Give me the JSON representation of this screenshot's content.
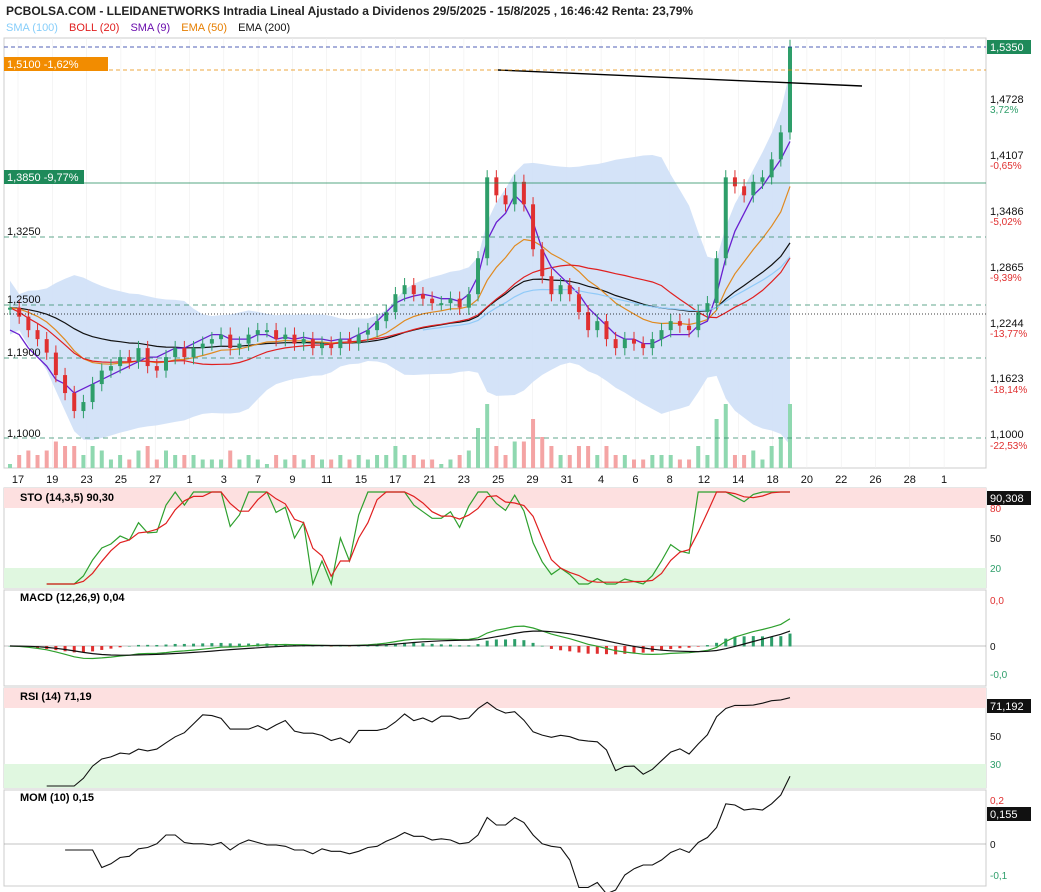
{
  "header": {
    "title": "PCBOLSA.COM - LLEIDANETWORKS Intradia Lineal Ajustado a Dividenos 29/5/2025 - 15/8/2025 , 16:46:42 Renta: 23,79%"
  },
  "legend": [
    {
      "label": "SMA (100)",
      "color": "#87cefa"
    },
    {
      "label": "BOLL (20)",
      "color": "#e02020"
    },
    {
      "label": "SMA (9)",
      "color": "#6a0dad"
    },
    {
      "label": "EMA (50)",
      "color": "#e67e00"
    },
    {
      "label": "EMA (200)",
      "color": "#111111"
    }
  ],
  "colors": {
    "up": "#2e9e6a",
    "down": "#e03030",
    "boll_fill": "#cfe0f7",
    "sma9": "#6a20d0",
    "boll_mid": "#e02020",
    "ema50": "#e08a20",
    "ema200": "#111111",
    "sma100": "#90caf8",
    "grid": "#e6e6e6",
    "orange_badge": "#f28c00",
    "green_badge": "#1e8a5a"
  },
  "price_axis": {
    "labels": [
      "1,5350",
      "1,4728",
      "1,4107",
      "1,3486",
      "1,2865",
      "1,2244",
      "1,1623",
      "1,1000"
    ],
    "percents": [
      "3,72%",
      "-0,65%",
      "-5,02%",
      "-9,39%",
      "-13,77%",
      "-18,14%",
      "-22,53%"
    ],
    "current": "1,5350"
  },
  "levels": {
    "resistance_badge": "1,5100  -1,62%",
    "support_badge": "1,3850  -9,77%",
    "left_labels": [
      "1,3250",
      "1,2500",
      "1,1900",
      "1,1000"
    ]
  },
  "x_axis": {
    "labels": [
      "17",
      "19",
      "23",
      "25",
      "27",
      "1",
      "3",
      "7",
      "9",
      "11",
      "15",
      "17",
      "21",
      "23",
      "25",
      "29",
      "31",
      "4",
      "6",
      "8",
      "12",
      "14",
      "18",
      "20",
      "22",
      "26",
      "28",
      "1"
    ]
  },
  "indicators": {
    "sto": {
      "label": "STO (14,3,5)",
      "value": "90,30",
      "box": "90,308",
      "levels": [
        "80",
        "50",
        "20"
      ]
    },
    "macd": {
      "label": "MACD (12,26,9)",
      "value": "0,04",
      "levels": [
        "0,0",
        "0",
        "-0,0"
      ]
    },
    "rsi": {
      "label": "RSI (14)",
      "value": "71,19",
      "box": "71,192",
      "levels": [
        "50",
        "30"
      ]
    },
    "mom": {
      "label": "MOM (10)",
      "value": "0,15",
      "box": "0,155",
      "levels": [
        "0,2",
        "0",
        "-0,1"
      ]
    }
  },
  "chart_data": {
    "type": "line",
    "title": "PCBOLSA.COM - LLEIDANETWORKS Intradia Lineal Ajustado a Dividenos 29/5/2025 - 15/8/2025 , 16:46:42 Renta: 23,79%",
    "ylim": [
      1.1,
      1.535
    ],
    "close": [
      1.245,
      1.235,
      1.22,
      1.21,
      1.195,
      1.17,
      1.15,
      1.13,
      1.14,
      1.16,
      1.175,
      1.18,
      1.19,
      1.185,
      1.2,
      1.18,
      1.175,
      1.19,
      1.2,
      1.19,
      1.2,
      1.205,
      1.21,
      1.215,
      1.2,
      1.205,
      1.215,
      1.22,
      1.22,
      1.21,
      1.215,
      1.205,
      1.21,
      1.2,
      1.205,
      1.2,
      1.21,
      1.205,
      1.215,
      1.22,
      1.23,
      1.24,
      1.26,
      1.27,
      1.26,
      1.255,
      1.25,
      1.25,
      1.255,
      1.245,
      1.26,
      1.3,
      1.39,
      1.37,
      1.36,
      1.385,
      1.36,
      1.31,
      1.28,
      1.26,
      1.27,
      1.26,
      1.24,
      1.22,
      1.23,
      1.21,
      1.2,
      1.21,
      1.205,
      1.2,
      1.21,
      1.22,
      1.23,
      1.225,
      1.22,
      1.24,
      1.25,
      1.3,
      1.39,
      1.38,
      1.37,
      1.385,
      1.39,
      1.41,
      1.44,
      1.535
    ],
    "sma9": [
      1.22,
      1.215,
      1.2,
      1.19,
      1.18,
      1.165,
      1.16,
      1.15,
      1.155,
      1.16,
      1.165,
      1.17,
      1.175,
      1.18,
      1.185,
      1.19,
      1.19,
      1.195,
      1.2,
      1.2,
      1.205,
      1.21,
      1.215,
      1.215,
      1.21,
      1.21,
      1.21,
      1.215,
      1.215,
      1.21,
      1.212,
      1.21,
      1.212,
      1.21,
      1.21,
      1.208,
      1.21,
      1.21,
      1.215,
      1.22,
      1.23,
      1.24,
      1.25,
      1.255,
      1.258,
      1.26,
      1.258,
      1.255,
      1.255,
      1.252,
      1.26,
      1.28,
      1.32,
      1.34,
      1.35,
      1.37,
      1.36,
      1.34,
      1.31,
      1.29,
      1.28,
      1.27,
      1.26,
      1.245,
      1.235,
      1.225,
      1.215,
      1.21,
      1.21,
      1.205,
      1.205,
      1.21,
      1.215,
      1.215,
      1.215,
      1.225,
      1.23,
      1.26,
      1.3,
      1.33,
      1.35,
      1.37,
      1.38,
      1.395,
      1.41,
      1.43
    ]
  }
}
